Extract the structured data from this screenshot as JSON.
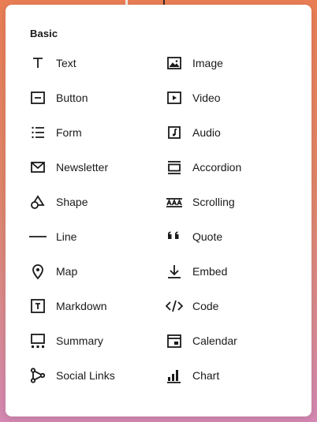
{
  "panel": {
    "section_title": "Basic",
    "items": [
      {
        "label": "Text",
        "icon": "text-icon"
      },
      {
        "label": "Image",
        "icon": "image-icon"
      },
      {
        "label": "Button",
        "icon": "button-icon"
      },
      {
        "label": "Video",
        "icon": "video-icon"
      },
      {
        "label": "Form",
        "icon": "form-icon"
      },
      {
        "label": "Audio",
        "icon": "audio-icon"
      },
      {
        "label": "Newsletter",
        "icon": "newsletter-icon"
      },
      {
        "label": "Accordion",
        "icon": "accordion-icon"
      },
      {
        "label": "Shape",
        "icon": "shape-icon"
      },
      {
        "label": "Scrolling",
        "icon": "scrolling-icon"
      },
      {
        "label": "Line",
        "icon": "line-icon"
      },
      {
        "label": "Quote",
        "icon": "quote-icon"
      },
      {
        "label": "Map",
        "icon": "map-pin-icon"
      },
      {
        "label": "Embed",
        "icon": "embed-icon"
      },
      {
        "label": "Markdown",
        "icon": "markdown-icon"
      },
      {
        "label": "Code",
        "icon": "code-icon"
      },
      {
        "label": "Summary",
        "icon": "summary-icon"
      },
      {
        "label": "Calendar",
        "icon": "calendar-icon"
      },
      {
        "label": "Social Links",
        "icon": "social-links-icon"
      },
      {
        "label": "Chart",
        "icon": "chart-icon"
      }
    ]
  }
}
